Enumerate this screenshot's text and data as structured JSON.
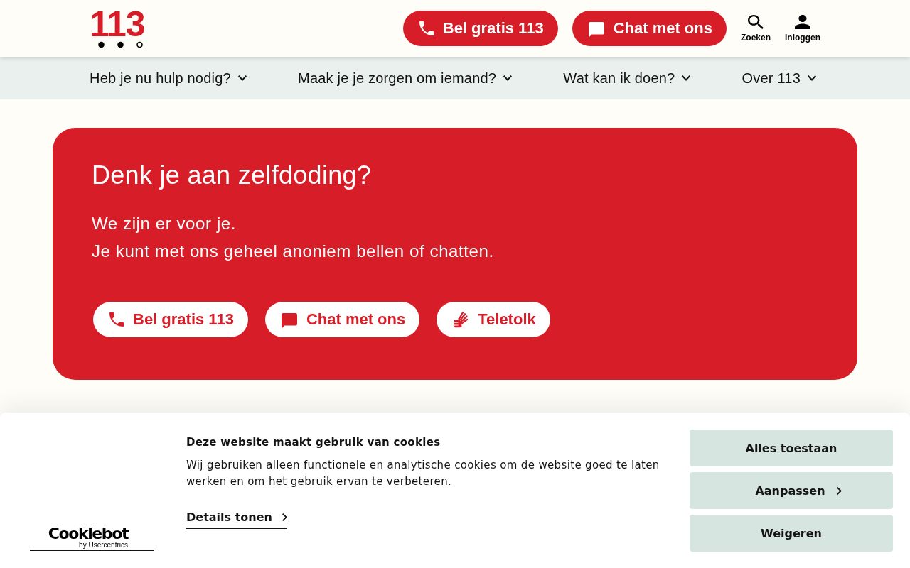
{
  "header": {
    "logo": "113",
    "buttons": [
      {
        "kind": "call",
        "label": "Bel gratis 113"
      },
      {
        "kind": "chat",
        "label": "Chat met ons"
      }
    ],
    "tools": [
      {
        "kind": "search",
        "label": "Zoeken"
      },
      {
        "kind": "user",
        "label": "Inloggen"
      }
    ]
  },
  "nav": {
    "items": [
      {
        "label": "Heb je nu hulp nodig?"
      },
      {
        "label": "Maak je je zorgen om iemand?"
      },
      {
        "label": "Wat kan ik doen?"
      },
      {
        "label": "Over 113"
      }
    ]
  },
  "hero": {
    "title": "Denk je aan zelfdoding?",
    "lines": [
      "We zijn er voor je.",
      "Je kunt met ons geheel anoniem bellen of chatten."
    ],
    "buttons": [
      {
        "kind": "call",
        "label": "Bel gratis 113"
      },
      {
        "kind": "chat",
        "label": "Chat met ons"
      },
      {
        "kind": "sign",
        "label": "Teletolk"
      }
    ]
  },
  "cookie_banner": {
    "logo": {
      "name": "Cookiebot",
      "tagline": "by Usercentrics"
    },
    "title": "Deze website maakt gebruik van cookies",
    "text": "Wij gebruiken alleen functionele en analytische cookies om de website goed te laten werken en om het gebruik ervan te verbeteren.",
    "link": "Details tonen",
    "buttons": [
      {
        "kind": "plain",
        "label": "Alles toestaan"
      },
      {
        "kind": "more",
        "label": "Aanpassen"
      },
      {
        "kind": "plain",
        "label": "Weigeren"
      }
    ]
  }
}
